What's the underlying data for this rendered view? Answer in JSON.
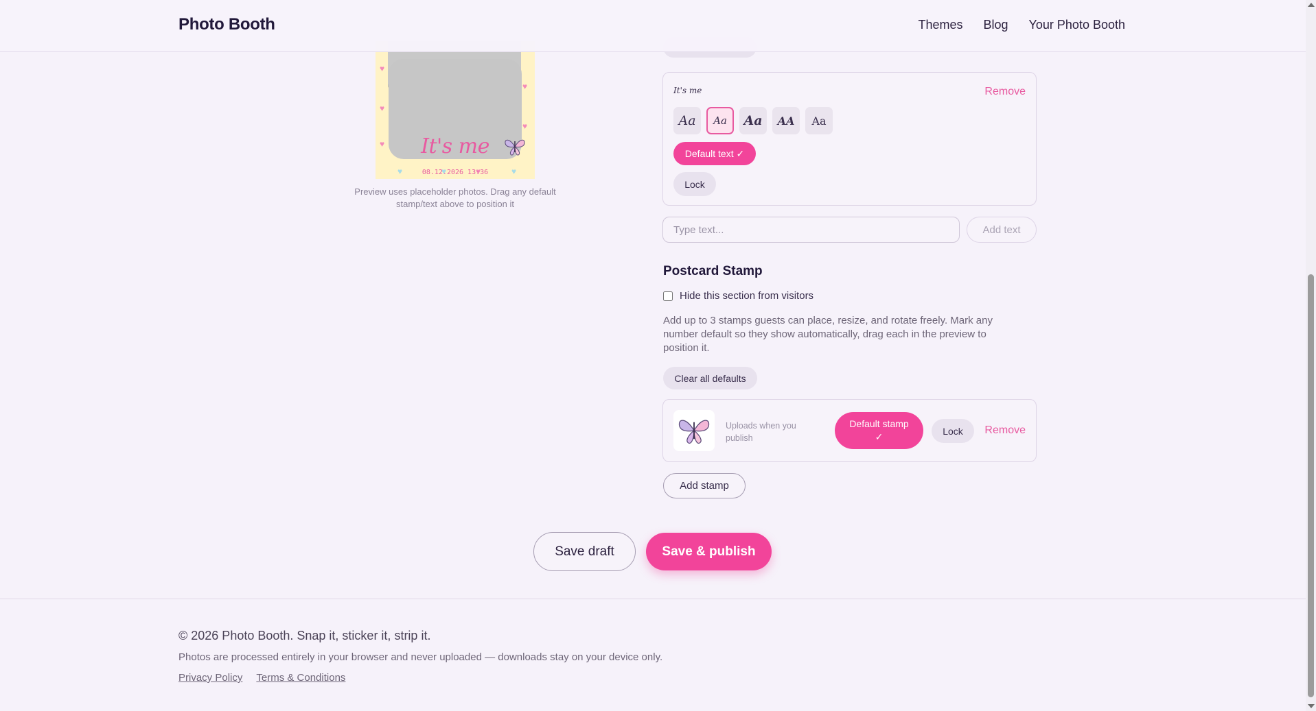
{
  "header": {
    "brand": "Photo Booth",
    "nav": [
      "Themes",
      "Blog",
      "Your Photo Booth"
    ]
  },
  "preview": {
    "strip_text": "It's me",
    "date_stamp": "08.12.2026 13:36",
    "note": "Preview uses placeholder photos. Drag any default stamp/text above to position it"
  },
  "text_item": {
    "label": "It's me",
    "remove": "Remove",
    "font_options": [
      "Aa",
      "Aa",
      "Aa",
      "AA",
      "Aa"
    ],
    "selected_font_index": 1,
    "default_button": "Default text ✓",
    "lock_button": "Lock"
  },
  "text_input": {
    "placeholder": "Type text...",
    "add_button": "Add text"
  },
  "postcard_stamp": {
    "title": "Postcard Stamp",
    "hide_label": "Hide this section from visitors",
    "hide_checked": false,
    "description": "Add up to 3 stamps guests can place, resize, and rotate freely. Mark any number default so they show automatically, drag each in the preview to position it.",
    "clear_defaults": "Clear all defaults",
    "stamp": {
      "note": "Uploads when you publish",
      "default_button_line1": "Default stamp",
      "default_button_line2": "✓",
      "lock_button": "Lock",
      "remove": "Remove"
    },
    "add_stamp": "Add stamp"
  },
  "actions": {
    "save_draft": "Save draft",
    "publish": "Save & publish"
  },
  "footer": {
    "copyright": "© 2026 Photo Booth. Snap it, sticker it, strip it.",
    "privacy_note": "Photos are processed entirely in your browser and never uploaded — downloads stay on your device only.",
    "links": [
      "Privacy Policy",
      "Terms & Conditions"
    ]
  },
  "colors": {
    "accent": "#f2449a",
    "strip_bg": "#fff3c6",
    "background": "#f6f2fa"
  }
}
